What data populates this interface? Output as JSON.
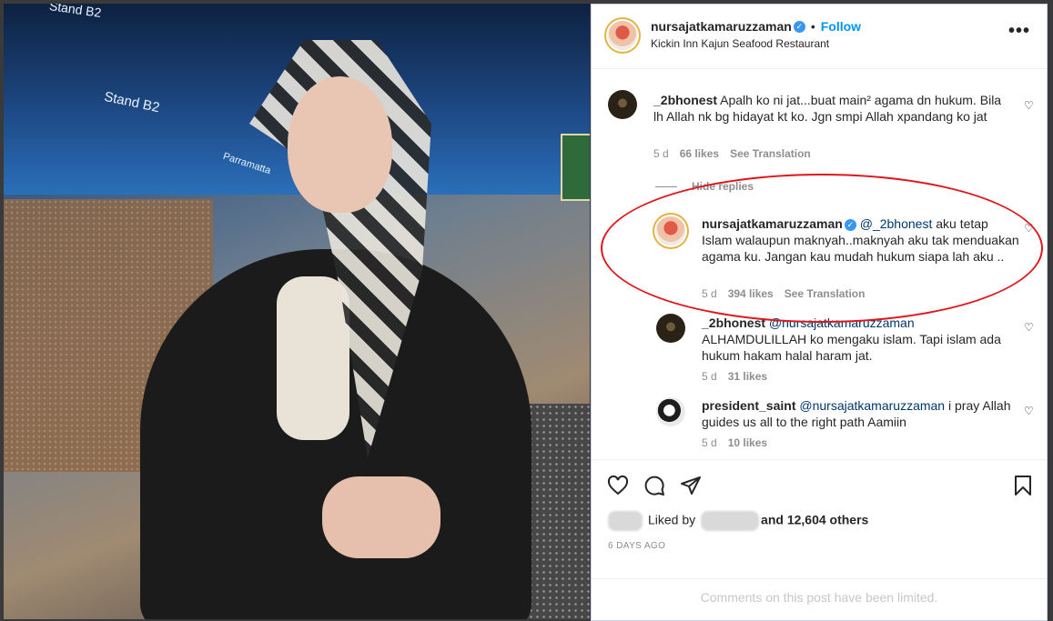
{
  "post": {
    "photo_signs": {
      "stand": "Stand B2",
      "platform": "Parramatta",
      "top": "Stand B2"
    },
    "author": {
      "username": "nursajatkamaruzzaman",
      "follow_label": "Follow",
      "location": "Kickin Inn Kajun Seafood Restaurant",
      "dot": "•"
    },
    "more_icon": "more-options-icon",
    "comments": [
      {
        "username": "_2bhonest",
        "text": "Apalh ko ni jat...buat main² agama dn hukum. Bila lh Allah nk bg hidayat kt ko. Jgn smpi Allah xpandang ko jat",
        "age": "5 d",
        "likes": "66 likes",
        "translate": "See Translation"
      }
    ],
    "hide_replies": "Hide replies",
    "replies": [
      {
        "username": "nursajatkamaruzzaman",
        "mention": "@_2bhonest",
        "text": " aku tetap Islam walaupun maknyah..maknyah aku tak menduakan agama ku. Jangan kau mudah hukum siapa lah aku ..",
        "age": "5 d",
        "likes": "394 likes",
        "translate": "See Translation"
      },
      {
        "username": "_2bhonest",
        "mention": "@nursajatkamaruzzaman",
        "text": "ALHAMDULILLAH ko mengaku islam. Tapi islam ada hukum hakam halal haram jat.",
        "age": "5 d",
        "likes": "31 likes"
      },
      {
        "username": "president_saint",
        "mention": "@nursajatkamaruzzaman",
        "text": " i pray Allah guides us all to the right path Aamiin",
        "age": "5 d",
        "likes": "10 likes"
      }
    ],
    "actions": {
      "like_icon": "heart-icon",
      "comment_icon": "comment-icon",
      "share_icon": "send-icon",
      "save_icon": "bookmark-icon"
    },
    "liked_by": {
      "prefix": "Liked by",
      "suffix": "and 12,604 others"
    },
    "timestamp": "6 DAYS AGO",
    "comments_limited": "Comments on this post have been limited."
  },
  "colors": {
    "link": "#0095f6",
    "verified": "#3897f0",
    "annotation_oval": "#e0161b"
  }
}
